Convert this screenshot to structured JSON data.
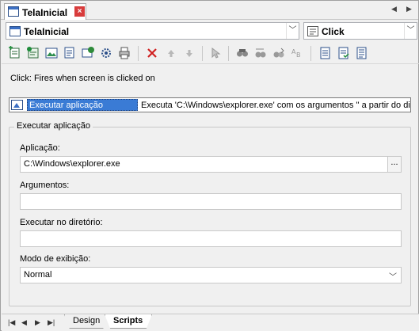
{
  "tab": {
    "title": "TelaInicial",
    "close": "×"
  },
  "object_combo": {
    "value": "TelaInicial"
  },
  "event_combo": {
    "value": "Click"
  },
  "event_description": "Click: Fires when screen is clicked on",
  "script_row": {
    "action": "Executar aplicação",
    "detail": "Executa 'C:\\Windows\\explorer.exe' com os argumentos '' a partir do diretório ''"
  },
  "group": {
    "title": "Executar aplicação",
    "app_label": "Aplicação:",
    "app_value": "C:\\Windows\\explorer.exe",
    "browse_label": "...",
    "args_label": "Argumentos:",
    "args_value": "",
    "dir_label": "Executar no diretório:",
    "dir_value": "",
    "mode_label": "Modo de exibição:",
    "mode_value": "Normal"
  },
  "bottom_tabs": {
    "design": "Design",
    "scripts": "Scripts"
  },
  "colors": {
    "selection": "#3a7bd5",
    "delete": "#d02020"
  },
  "icons": [
    "add-script-icon",
    "add-action-icon",
    "image-action-icon",
    "insert-action-icon",
    "record-icon",
    "settings-icon",
    "print-icon",
    "delete-icon",
    "move-up-icon",
    "move-down-icon",
    "cursor-icon",
    "find-icon",
    "find-replace-icon",
    "find-next-icon",
    "spellcheck-icon",
    "list-icon",
    "check-list-icon",
    "edit-list-icon"
  ]
}
